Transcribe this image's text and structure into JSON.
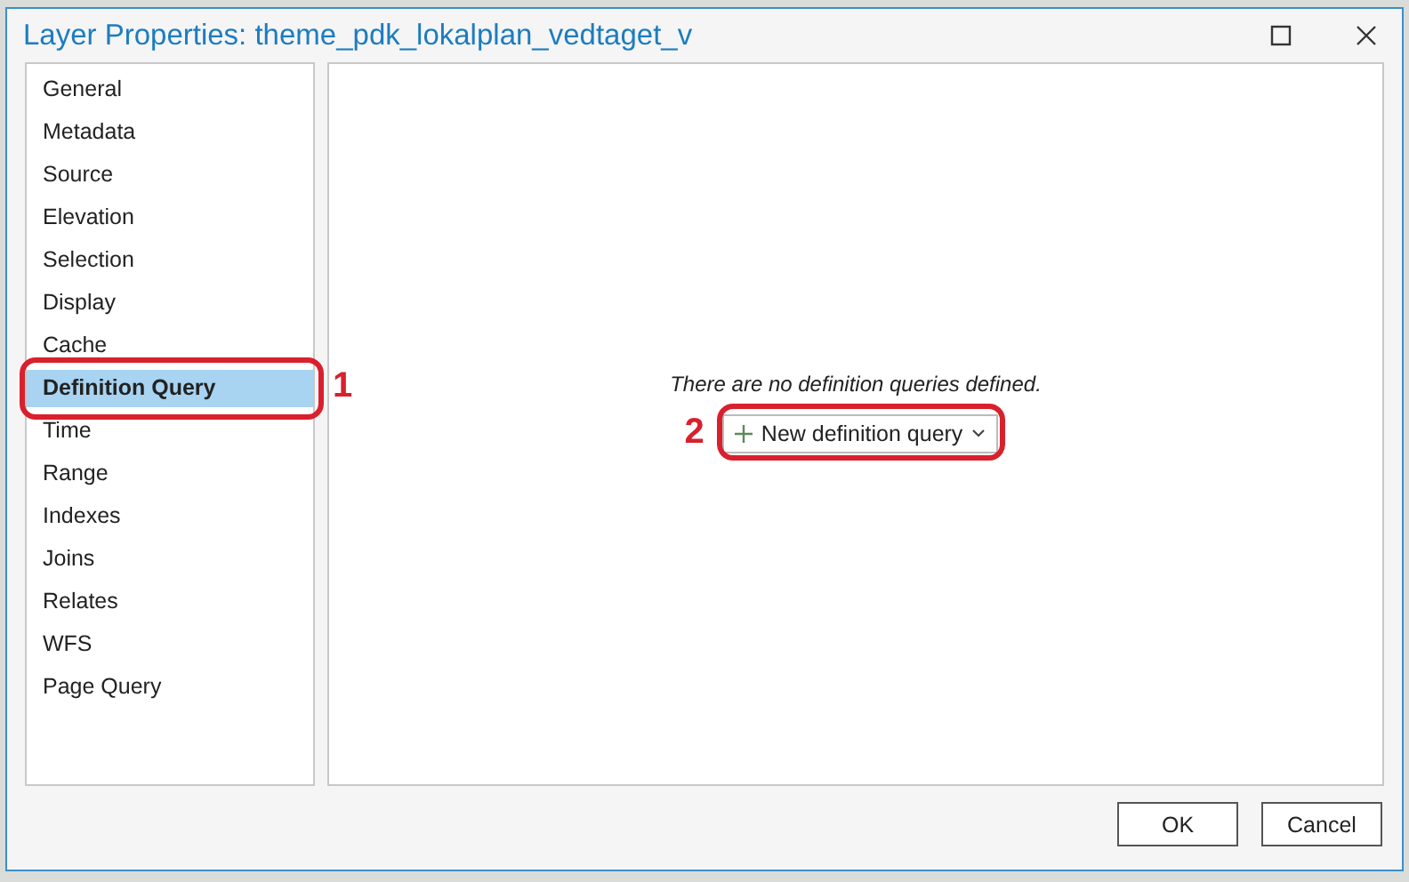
{
  "window": {
    "title": "Layer Properties: theme_pdk_lokalplan_vedtaget_v"
  },
  "sidebar": {
    "items": [
      {
        "label": "General",
        "selected": false
      },
      {
        "label": "Metadata",
        "selected": false
      },
      {
        "label": "Source",
        "selected": false
      },
      {
        "label": "Elevation",
        "selected": false
      },
      {
        "label": "Selection",
        "selected": false
      },
      {
        "label": "Display",
        "selected": false
      },
      {
        "label": "Cache",
        "selected": false
      },
      {
        "label": "Definition Query",
        "selected": true,
        "callout": "1"
      },
      {
        "label": "Time",
        "selected": false
      },
      {
        "label": "Range",
        "selected": false
      },
      {
        "label": "Indexes",
        "selected": false
      },
      {
        "label": "Joins",
        "selected": false
      },
      {
        "label": "Relates",
        "selected": false
      },
      {
        "label": "WFS",
        "selected": false
      },
      {
        "label": "Page Query",
        "selected": false
      }
    ]
  },
  "content": {
    "message": "There are no definition queries defined.",
    "new_button": {
      "label": "New definition query",
      "callout": "2"
    }
  },
  "buttons": [
    "OK",
    "Cancel"
  ]
}
